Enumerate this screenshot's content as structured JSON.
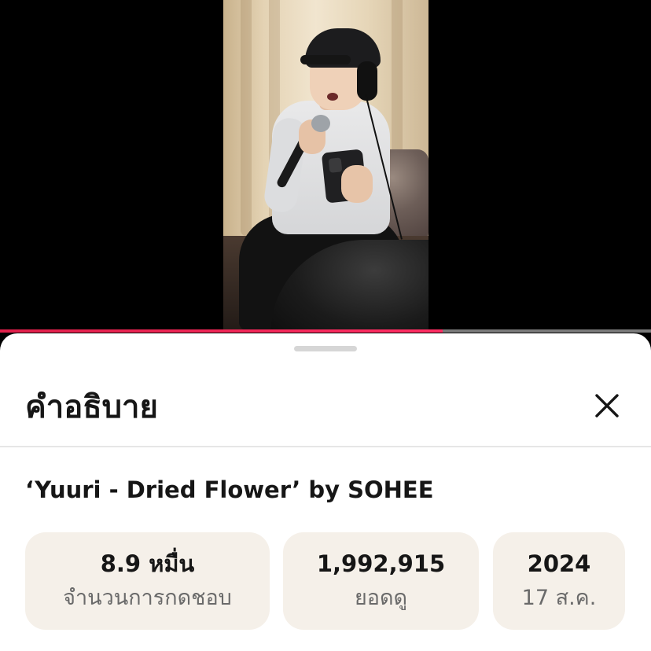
{
  "video": {
    "progress_percent": 68
  },
  "description_panel": {
    "title": "คำอธิบาย",
    "close_icon": "close-icon",
    "video_title": "‘Yuuri - Dried Flower’ by SOHEE",
    "stats": {
      "likes_value": "8.9 หมื่น",
      "likes_label": "จำนวนการกดชอบ",
      "views_value": "1,992,915",
      "views_label": "ยอดดู",
      "year": "2024",
      "date": "17 ส.ค."
    }
  },
  "colors": {
    "progress": "#ff2e63",
    "stat_background": "#f5f0e9"
  }
}
